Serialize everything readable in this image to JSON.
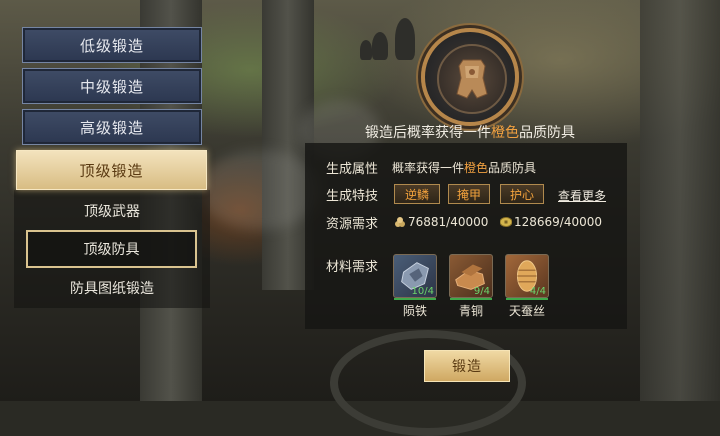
{
  "menu": {
    "tiers": [
      {
        "label": "低级锻造"
      },
      {
        "label": "中级锻造"
      },
      {
        "label": "高级锻造"
      },
      {
        "label": "顶级锻造"
      }
    ],
    "sub_items": [
      {
        "label": "顶级武器"
      },
      {
        "label": "顶级防具"
      },
      {
        "label": "防具图纸锻造"
      }
    ]
  },
  "header": {
    "text_before": "锻造后概率获得一件",
    "highlight": "橙色",
    "text_after": "品质防具"
  },
  "details": {
    "attr_label": "生成属性",
    "attr_before": "概率获得一件",
    "attr_highlight": "橙色",
    "attr_after": "品质防具",
    "skill_label": "生成特技",
    "skills": [
      "逆鳞",
      "掩甲",
      "护心"
    ],
    "more_link": "查看更多",
    "resource_label": "资源需求",
    "resources": [
      {
        "icon": "grain-icon",
        "value": "76881/40000"
      },
      {
        "icon": "coin-icon",
        "value": "128669/40000"
      }
    ],
    "material_label": "材料需求",
    "materials": [
      {
        "name": "陨铁",
        "count": "10/4",
        "icon": "meteor-iron-icon"
      },
      {
        "name": "青铜",
        "count": "9/4",
        "icon": "bronze-icon"
      },
      {
        "name": "天蚕丝",
        "count": "4/4",
        "icon": "silk-cocoon-icon"
      }
    ]
  },
  "forge_button": "锻造",
  "colors": {
    "orange_quality": "#f0a040",
    "accent_gold": "#d8bd83",
    "menu_blue": "#2c3750"
  }
}
